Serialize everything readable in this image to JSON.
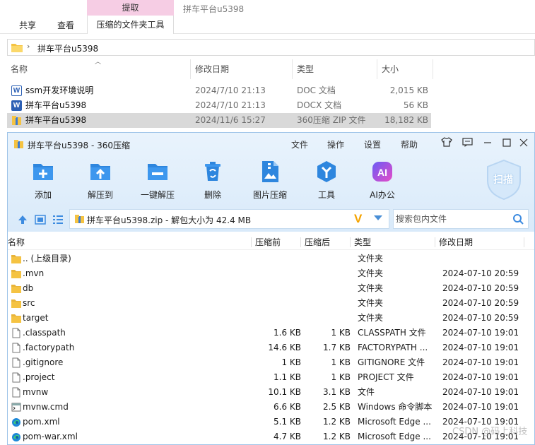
{
  "explorer": {
    "context_tab": "提取",
    "context_title": "拼车平台u5398",
    "ribbon_tabs": [
      "共享",
      "查看",
      "压缩的文件夹工具"
    ],
    "address_path": "拼车平台u5398",
    "columns": {
      "name": "名称",
      "date": "修改日期",
      "type": "类型",
      "size": "大小"
    },
    "files": [
      {
        "name": "ssm开发环境说明",
        "date": "2024/7/10 21:13",
        "type": "DOC 文档",
        "size": "2,015 KB",
        "icon": "word-doc-icon"
      },
      {
        "name": "拼车平台u5398",
        "date": "2024/7/10 21:13",
        "type": "DOCX 文档",
        "size": "56 KB",
        "icon": "word-docx-icon"
      },
      {
        "name": "拼车平台u5398",
        "date": "2024/11/6 15:27",
        "type": "360压缩 ZIP 文件",
        "size": "18,182 KB",
        "icon": "zip-archive-icon",
        "selected": true
      }
    ]
  },
  "archive_window": {
    "title": "拼车平台u5398 - 360压缩",
    "menu": [
      "文件",
      "操作",
      "设置",
      "帮助"
    ],
    "tools": [
      {
        "label": "添加",
        "icon": "add-icon"
      },
      {
        "label": "解压到",
        "icon": "extract-to-icon"
      },
      {
        "label": "一键解压",
        "icon": "one-click-extract-icon"
      },
      {
        "label": "删除",
        "icon": "delete-icon"
      },
      {
        "label": "图片压缩",
        "icon": "image-compress-icon"
      },
      {
        "label": "工具",
        "icon": "tools-icon"
      },
      {
        "label": "AI办公",
        "icon": "ai-office-icon"
      }
    ],
    "scan_label": "扫描",
    "path_text": "拼车平台u5398.zip - 解包大小为 42.4 MB",
    "search_placeholder": "搜索包内文件",
    "columns": {
      "name": "名称",
      "size": "压缩前",
      "compressed": "压缩后",
      "type": "类型",
      "date": "修改日期"
    },
    "entries": [
      {
        "name": ".. (上级目录)",
        "size": "",
        "compressed": "",
        "type": "文件夹",
        "date": "",
        "icon": "folder-icon"
      },
      {
        "name": ".mvn",
        "size": "",
        "compressed": "",
        "type": "文件夹",
        "date": "2024-07-10 20:59",
        "icon": "folder-icon"
      },
      {
        "name": "db",
        "size": "",
        "compressed": "",
        "type": "文件夹",
        "date": "2024-07-10 20:59",
        "icon": "folder-icon"
      },
      {
        "name": "src",
        "size": "",
        "compressed": "",
        "type": "文件夹",
        "date": "2024-07-10 20:59",
        "icon": "folder-icon"
      },
      {
        "name": "target",
        "size": "",
        "compressed": "",
        "type": "文件夹",
        "date": "2024-07-10 20:59",
        "icon": "folder-icon"
      },
      {
        "name": ".classpath",
        "size": "1.6 KB",
        "compressed": "1 KB",
        "type": "CLASSPATH 文件",
        "date": "2024-07-10 19:01",
        "icon": "file-icon"
      },
      {
        "name": ".factorypath",
        "size": "14.6 KB",
        "compressed": "1.7 KB",
        "type": "FACTORYPATH ...",
        "date": "2024-07-10 19:01",
        "icon": "file-icon"
      },
      {
        "name": ".gitignore",
        "size": "1 KB",
        "compressed": "1 KB",
        "type": "GITIGNORE 文件",
        "date": "2024-07-10 19:01",
        "icon": "file-icon"
      },
      {
        "name": ".project",
        "size": "1.1 KB",
        "compressed": "1 KB",
        "type": "PROJECT 文件",
        "date": "2024-07-10 19:01",
        "icon": "file-icon"
      },
      {
        "name": "mvnw",
        "size": "10.1 KB",
        "compressed": "3.1 KB",
        "type": "文件",
        "date": "2024-07-10 19:01",
        "icon": "file-icon"
      },
      {
        "name": "mvnw.cmd",
        "size": "6.6 KB",
        "compressed": "2.5 KB",
        "type": "Windows 命令脚本",
        "date": "2024-07-10 19:01",
        "icon": "cmd-script-icon"
      },
      {
        "name": "pom.xml",
        "size": "5.1 KB",
        "compressed": "1.2 KB",
        "type": "Microsoft Edge ...",
        "date": "2024-07-10 19:01",
        "icon": "edge-icon"
      },
      {
        "name": "pom-war.xml",
        "size": "4.7 KB",
        "compressed": "1.2 KB",
        "type": "Microsoft Edge ...",
        "date": "2024-07-10 19:01",
        "icon": "edge-icon"
      }
    ]
  },
  "watermark": "CSDN @码上科技",
  "colors": {
    "accent_blue": "#2e86de",
    "folder_yellow": "#f5c342",
    "context_pink": "#f6cde4",
    "v_orange": "#f5a300"
  }
}
